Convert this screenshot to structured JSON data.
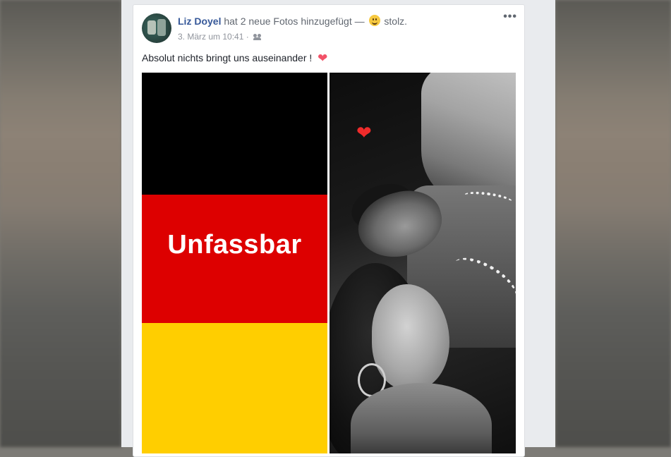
{
  "post": {
    "author": "Liz Doyel",
    "action": "hat 2 neue Fotos hinzugefügt —",
    "feeling": "stolz.",
    "timestamp": "3. März um 10:41",
    "separator": "·",
    "more_label": "•••",
    "text": "Absolut nichts bringt uns auseinander !",
    "heart_icon": "❤",
    "photos": [
      {
        "type": "german-flag-graphic",
        "overlay_text": "Unfassbar"
      },
      {
        "type": "black-and-white-couple-photo",
        "sticker": "❤"
      }
    ]
  },
  "colors": {
    "link": "#365899",
    "flag_black": "#000000",
    "flag_red": "#dd0000",
    "flag_gold": "#ffce00",
    "heart": "#f25268"
  }
}
